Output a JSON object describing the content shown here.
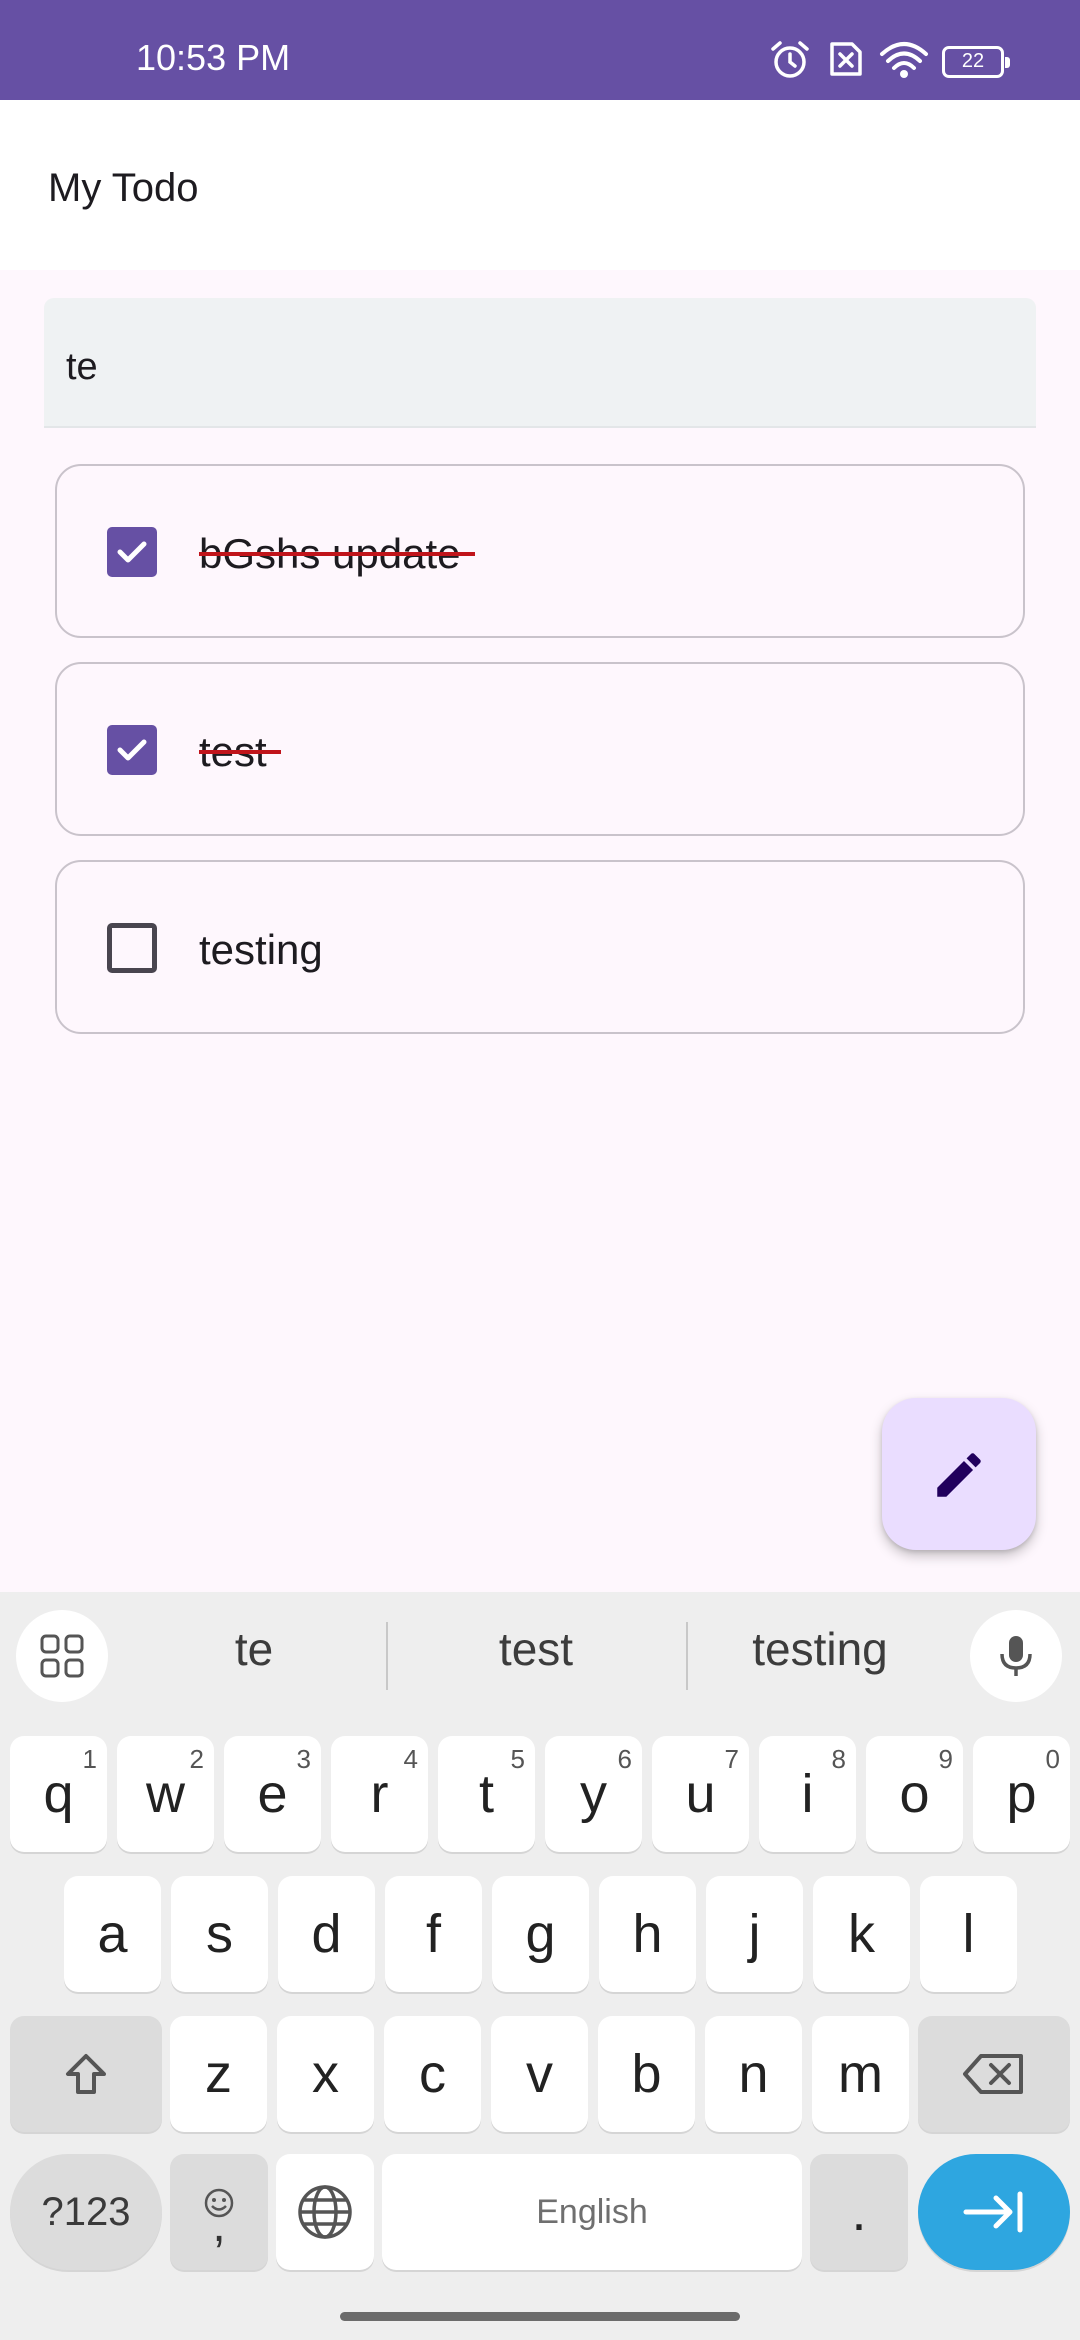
{
  "status_bar": {
    "time": "10:53 PM",
    "battery": "22",
    "icons": [
      "alarm-icon",
      "no-sim-icon",
      "wifi-icon",
      "battery-icon"
    ]
  },
  "app_bar": {
    "title": "My Todo"
  },
  "search": {
    "value": "te"
  },
  "todos": [
    {
      "text": "bGshs update",
      "checked": true
    },
    {
      "text": "test",
      "checked": true
    },
    {
      "text": "testing",
      "checked": false
    }
  ],
  "fab": {
    "icon": "edit-pencil-icon"
  },
  "keyboard": {
    "suggestions": [
      "te",
      "test",
      "testing"
    ],
    "row1": [
      {
        "label": "q",
        "hint": "1"
      },
      {
        "label": "w",
        "hint": "2"
      },
      {
        "label": "e",
        "hint": "3"
      },
      {
        "label": "r",
        "hint": "4"
      },
      {
        "label": "t",
        "hint": "5"
      },
      {
        "label": "y",
        "hint": "6"
      },
      {
        "label": "u",
        "hint": "7"
      },
      {
        "label": "i",
        "hint": "8"
      },
      {
        "label": "o",
        "hint": "9"
      },
      {
        "label": "p",
        "hint": "0"
      }
    ],
    "row2": [
      "a",
      "s",
      "d",
      "f",
      "g",
      "h",
      "j",
      "k",
      "l"
    ],
    "row3": [
      "z",
      "x",
      "c",
      "v",
      "b",
      "n",
      "m"
    ],
    "num_key": "?123",
    "comma_key": ",",
    "space_label": "English",
    "period_key": "."
  },
  "colors": {
    "primary": "#6650a4",
    "strike": "#c0141b",
    "fab_bg": "#eaddff",
    "enter_key": "#2ea6e0"
  }
}
